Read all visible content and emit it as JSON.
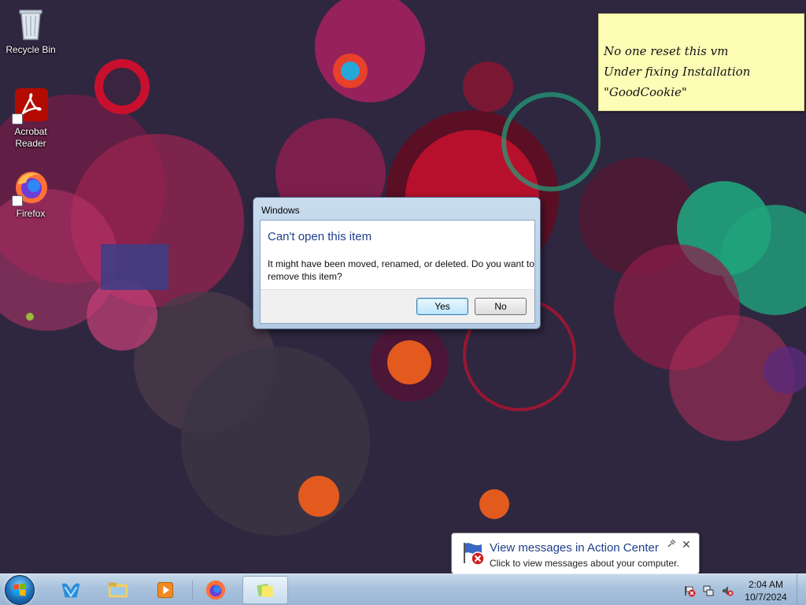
{
  "desktop": {
    "icons": [
      {
        "label": "Recycle Bin"
      },
      {
        "label": "Acrobat Reader"
      },
      {
        "label": "Firefox"
      }
    ]
  },
  "sticky_note": {
    "lines": [
      "No one reset this vm",
      "Under fixing Installation",
      "\"GoodCookie\""
    ]
  },
  "dialog": {
    "title": "Windows",
    "heading": "Can't open this item",
    "message": "It might have been moved, renamed, or deleted. Do you want to remove this item?",
    "yes_label": "Yes",
    "no_label": "No"
  },
  "notification": {
    "title": "View messages in Action Center",
    "subtitle": "Click to view messages about your computer.",
    "close_glyph": "✕"
  },
  "taskbar": {
    "pinned": [
      "start",
      "windows-live",
      "file-explorer",
      "media-player",
      "firefox",
      "sticky-notes"
    ],
    "clock_time": "2:04 AM",
    "clock_date": "10/7/2024"
  }
}
